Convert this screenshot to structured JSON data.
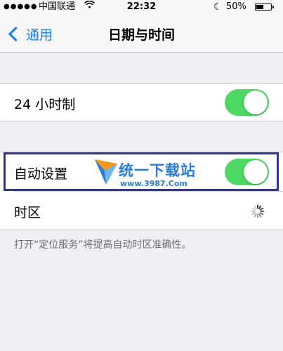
{
  "status_bar": {
    "signal": "●●●●●",
    "carrier": "中国联通",
    "wifi_icon": "wifi-icon",
    "time": "22:32",
    "moon_icon": "moon-icon",
    "battery_percent": "50%",
    "battery_level": 0.5
  },
  "nav": {
    "back_label": "通用",
    "title": "日期与时间"
  },
  "settings": {
    "hour24": {
      "label": "24 小时制",
      "on": true
    },
    "auto_set": {
      "label": "自动设置",
      "on": true
    },
    "timezone": {
      "label": "时区",
      "loading_icon": "spinner-icon"
    },
    "note": "打开“定位服务”将提高自动时区准确性。"
  },
  "watermark": {
    "text": "统一下载站",
    "url": "www.3987.Com"
  },
  "colors": {
    "accent": "#1a7cf5",
    "toggle_on": "#4cd964",
    "background": "#efeff4",
    "highlight": "#2e3595"
  }
}
